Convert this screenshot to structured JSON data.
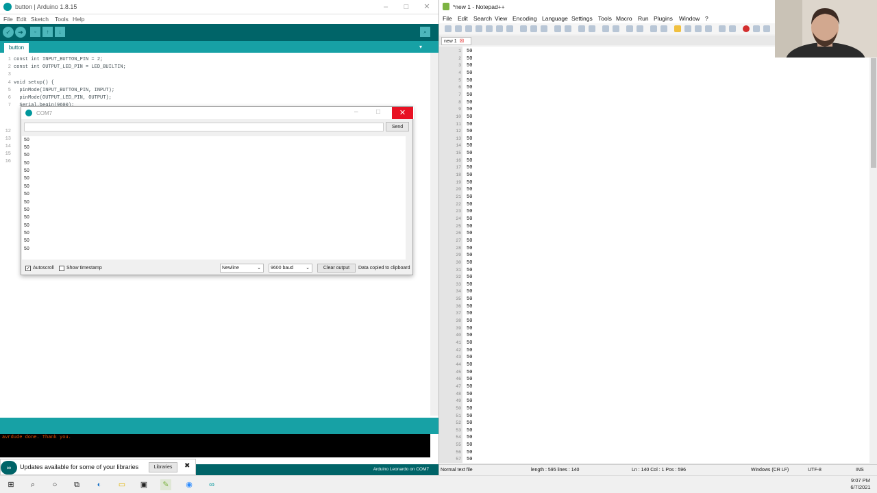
{
  "arduino": {
    "title": "button | Arduino 1.8.15",
    "menu": [
      "File",
      "Edit",
      "Sketch",
      "Tools",
      "Help"
    ],
    "tab": "button",
    "code": [
      {
        "n": "1",
        "text": "const int INPUT_BUTTON_PIN = 2;"
      },
      {
        "n": "2",
        "text": "const int OUTPUT_LED_PIN = LED_BUILTIN;"
      },
      {
        "n": "3",
        "text": ""
      },
      {
        "n": "4",
        "text": "void setup() {"
      },
      {
        "n": "5",
        "text": "  pinMode(INPUT_BUTTON_PIN, INPUT);"
      },
      {
        "n": "6",
        "text": "  pinMode(OUTPUT_LED_PIN, OUTPUT);"
      },
      {
        "n": "7",
        "text": "  Serial.begin(9600);"
      }
    ],
    "partial_lines": [
      "8",
      "9",
      "10",
      "11",
      "12",
      "13",
      "14",
      "15",
      "16"
    ],
    "console": "avrdude done.  Thank you.",
    "status": "Arduino Leonardo on COM7",
    "notification": {
      "text": "Updates available for some of your libraries",
      "button": "Libraries"
    }
  },
  "serial": {
    "title": "COM7",
    "send": "Send",
    "output": [
      "50",
      "50",
      "50",
      "50",
      "50",
      "50",
      "50",
      "50",
      "50",
      "50",
      "50",
      "50",
      "50",
      "50",
      "50"
    ],
    "autoscroll": "Autoscroll",
    "timestamp": "Show timestamp",
    "line_ending": "Newline",
    "baud": "9600 baud",
    "clear": "Clear output",
    "copied": "Data copied to clipboard"
  },
  "npp": {
    "title": "*new 1 - Notepad++",
    "menu": [
      "File",
      "Edit",
      "Search",
      "View",
      "Encoding",
      "Language",
      "Settings",
      "Tools",
      "Macro",
      "Run",
      "Plugins",
      "Window",
      "?"
    ],
    "tab": "new 1",
    "value": "50",
    "line_count": 57,
    "status": {
      "type": "Normal text file",
      "length": "length : 595    lines : 140",
      "pos": "Ln : 140    Col : 1    Pos : 596",
      "eol": "Windows (CR LF)",
      "enc": "UTF-8",
      "ins": "INS"
    }
  },
  "taskbar": {
    "time": "9:07 PM",
    "date": "6/7/2021"
  }
}
